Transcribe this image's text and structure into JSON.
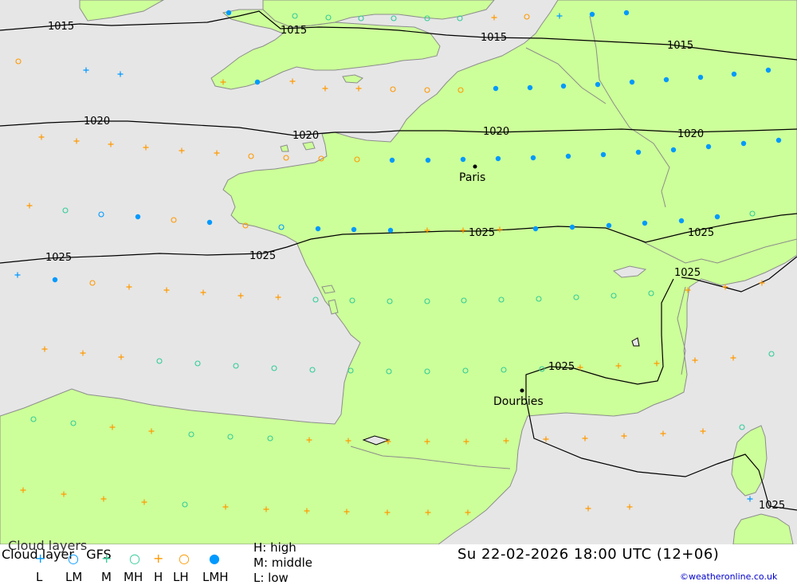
{
  "map": {
    "colors": {
      "sea": "#e6e6e6",
      "land": "#ccff99",
      "coast": "#8c8c8c",
      "isobar": "#000000",
      "cloud_blue": "#0099ff",
      "cloud_green": "#33cc99",
      "cloud_orange": "#ff9900"
    },
    "cities": [
      {
        "name": "Paris"
      },
      {
        "name": "Dourbies"
      }
    ],
    "isobar_labels": [
      "1015",
      "1015",
      "1015",
      "1015",
      "1020",
      "1020",
      "1020",
      "1020",
      "1025",
      "1025",
      "1025",
      "1025",
      "1025",
      "1025",
      "1025"
    ]
  },
  "footer": {
    "title_overlay_1": "Cloud layers",
    "title_overlay_2": "Cloud layer   GFS",
    "legend_high": "H: high",
    "legend_middle": "M: middle",
    "legend_low": "L: low",
    "datetime": "Su 22-02-2026 18:00 UTC (12+06)",
    "credit": "©weatheronline.co.uk",
    "legend_items": [
      {
        "label": "L",
        "symbol": "+",
        "color": "#0099ff"
      },
      {
        "label": "LM",
        "symbol": "○",
        "color": "#0099ff"
      },
      {
        "label": "M",
        "symbol": "+",
        "color": "#33cc99"
      },
      {
        "label": "MH",
        "symbol": "○",
        "color": "#33cc99"
      },
      {
        "label": "H",
        "symbol": "+",
        "color": "#ff9900"
      },
      {
        "label": "LH",
        "symbol": "○",
        "color": "#ff9900"
      },
      {
        "label": "LMH",
        "symbol": "●",
        "color": "#0099ff"
      }
    ]
  }
}
